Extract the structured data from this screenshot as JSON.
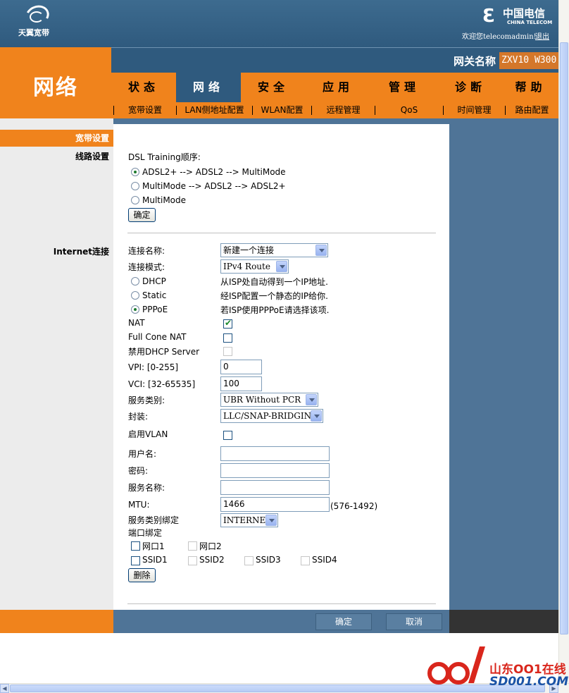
{
  "header": {
    "brand_left": "天翼宽带",
    "brand_cn": "中国电信",
    "brand_en": "CHINA TELECOM",
    "welcome": "欢迎您telecomadmin!",
    "logout": "退出"
  },
  "section_title": "网络",
  "gateway": {
    "label": "网关名称",
    "value": "ZXV10 W300"
  },
  "main_tabs": [
    {
      "label": "状态"
    },
    {
      "label": "网络"
    },
    {
      "label": "安全"
    },
    {
      "label": "应用"
    },
    {
      "label": "管理"
    },
    {
      "label": "诊断"
    },
    {
      "label": "帮助"
    }
  ],
  "sub_tabs": [
    {
      "label": "宽带设置"
    },
    {
      "label": "LAN侧地址配置"
    },
    {
      "label": "WLAN配置"
    },
    {
      "label": "远程管理"
    },
    {
      "label": "QoS"
    },
    {
      "label": "时间管理"
    },
    {
      "label": "路由配置"
    }
  ],
  "sidebar": {
    "active": "宽带设置",
    "line_settings": "线路设置",
    "internet_conn": "Internet连接"
  },
  "dsl": {
    "title": "DSL Training顺序:",
    "options": [
      "ADSL2+ --> ADSL2 --> MultiMode",
      "MultiMode --> ADSL2 --> ADSL2+",
      "MultiMode"
    ],
    "selected_index": 0,
    "confirm": "确定"
  },
  "conn": {
    "name_label": "连接名称:",
    "name_value": "新建一个连接",
    "mode_label": "连接模式:",
    "mode_value": "IPv4 Route",
    "modes": [
      {
        "label": "DHCP",
        "desc": "从ISP处自动得到一个IP地址."
      },
      {
        "label": "Static",
        "desc": "经ISP配置一个静态的IP给你."
      },
      {
        "label": "PPPoE",
        "desc": "若ISP使用PPPoE请选择该项."
      }
    ],
    "selected_mode": 2,
    "nat_label": "NAT",
    "nat_checked": true,
    "fullcone_label": "Full Cone NAT",
    "fullcone_checked": false,
    "dhcp_disable_label": "禁用DHCP Server",
    "vpi_label": "VPI: [0-255]",
    "vpi_value": "0",
    "vci_label": "VCI: [32-65535]",
    "vci_value": "100",
    "service_label": "服务类别:",
    "service_value": "UBR Without PCR",
    "encap_label": "封装:",
    "encap_value": "LLC/SNAP-BRIDGING",
    "vlan_label": "启用VLAN",
    "vlan_checked": false,
    "username_label": "用户名:",
    "username_value": "",
    "password_label": "密码:",
    "password_value": "",
    "servicename_label": "服务名称:",
    "servicename_value": "",
    "mtu_label": "MTU:",
    "mtu_value": "1466",
    "mtu_range": "(576-1492)",
    "bind_label": "服务类别绑定",
    "bind_value": "INTERNET",
    "port_bind_label": "端口绑定",
    "ports": [
      "网口1",
      "网口2"
    ],
    "ssids": [
      "SSID1",
      "SSID2",
      "SSID3",
      "SSID4"
    ],
    "delete": "删除"
  },
  "footer": {
    "confirm": "确定",
    "cancel": "取消"
  },
  "watermark": {
    "cn": "山东OO1在线",
    "en": "SD001.COM"
  },
  "colors": {
    "orange": "#f0831c",
    "navy": "#2f5a7e",
    "steel": "#4f7497"
  }
}
